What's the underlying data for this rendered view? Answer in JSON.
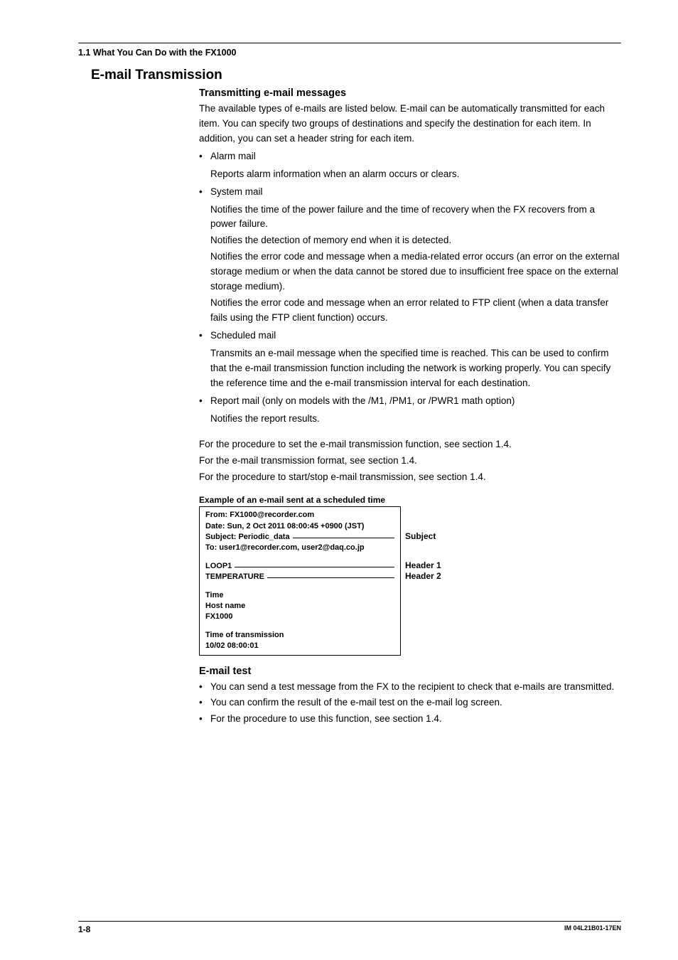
{
  "header": {
    "sectionPath": "1.1  What You Can Do with the FX1000"
  },
  "h2": "E-mail Transmission",
  "h3a": "Transmitting e-mail messages",
  "intro": "The available types of e-mails are listed below. E-mail can be automatically transmitted for each item. You can specify two groups of destinations and specify the destination for each item. In addition, you can set a header string for each item.",
  "items": {
    "alarm": {
      "title": "Alarm mail",
      "lines": [
        "Reports alarm information when an alarm occurs or clears."
      ]
    },
    "system": {
      "title": "System mail",
      "lines": [
        "Notifies the time of the power failure and the time of recovery when the FX recovers from a power failure.",
        "Notifies the detection of memory end when it is detected.",
        "Notifies the error code and message when a media-related error occurs (an error on the external storage medium or when the data cannot be stored due to insufficient free space on the external storage medium).",
        "Notifies the error code and message when an error related to FTP client (when a data transfer fails using the FTP client function) occurs."
      ]
    },
    "scheduled": {
      "title": "Scheduled mail",
      "lines": [
        "Transmits an e-mail message when the specified time is reached. This can be used to confirm that the e-mail transmission function including the network is working properly. You can specify the reference time and the e-mail transmission interval for each destination."
      ]
    },
    "report": {
      "title": "Report mail (only on models with the /M1, /PM1, or /PWR1 math option)",
      "lines": [
        "Notifies the report results."
      ]
    }
  },
  "refs": [
    "For the procedure to set the e-mail transmission function, see section 1.4.",
    "For the e-mail transmission format, see section 1.4.",
    "For the procedure to start/stop e-mail transmission, see section 1.4."
  ],
  "example": {
    "title": "Example of an e-mail sent at a scheduled time",
    "box": {
      "from": "From: FX1000@recorder.com",
      "date": "Date: Sun, 2 Oct 2011 08:00:45 +0900 (JST)",
      "subjectLine": "Subject: Periodic_data",
      "to": "To: user1@recorder.com, user2@daq.co.jp",
      "h1": "LOOP1",
      "h2": "TEMPERATURE",
      "block1": [
        "Time",
        "Host name",
        "FX1000"
      ],
      "block2": [
        "Time of transmission",
        "10/02 08:00:01"
      ]
    },
    "labels": {
      "subject": "Subject",
      "header1": "Header 1",
      "header2": "Header 2"
    }
  },
  "h3b": "E-mail test",
  "testBullets": [
    "You can send a test message from the FX to the recipient to check that e-mails are transmitted.",
    "You can confirm the result of the e-mail test on the e-mail log screen.",
    "For the procedure to use this function, see section 1.4."
  ],
  "footer": {
    "page": "1-8",
    "doc": "IM 04L21B01-17EN"
  }
}
